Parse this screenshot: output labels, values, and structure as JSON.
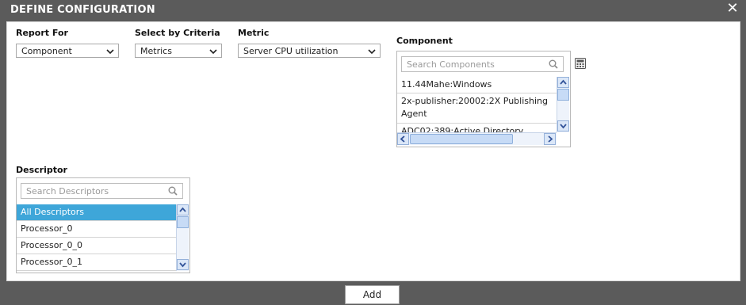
{
  "dialog": {
    "title": "DEFINE CONFIGURATION",
    "close_icon": "close-icon"
  },
  "fields": {
    "report_for": {
      "label": "Report For",
      "value": "Component"
    },
    "criteria": {
      "label": "Select by Criteria",
      "value": "Metrics"
    },
    "metric": {
      "label": "Metric",
      "value": "Server CPU utilization"
    }
  },
  "component": {
    "label": "Component",
    "search_placeholder": "Search Components",
    "items": [
      {
        "label": "11.44Mahe:Windows"
      },
      {
        "label": "2x-publisher:20002:2X Publishing Agent"
      },
      {
        "label": "ADC02:389:Active Directory"
      }
    ]
  },
  "descriptor": {
    "label": "Descriptor",
    "search_placeholder": "Search Descriptors",
    "items": [
      {
        "label": "All Descriptors",
        "selected": true
      },
      {
        "label": "Processor_0"
      },
      {
        "label": "Processor_0_0"
      },
      {
        "label": "Processor_0_1"
      }
    ]
  },
  "actions": {
    "add_label": "Add"
  },
  "colors": {
    "titlebar": "#5b5b5b",
    "selection": "#3ea6d9"
  }
}
